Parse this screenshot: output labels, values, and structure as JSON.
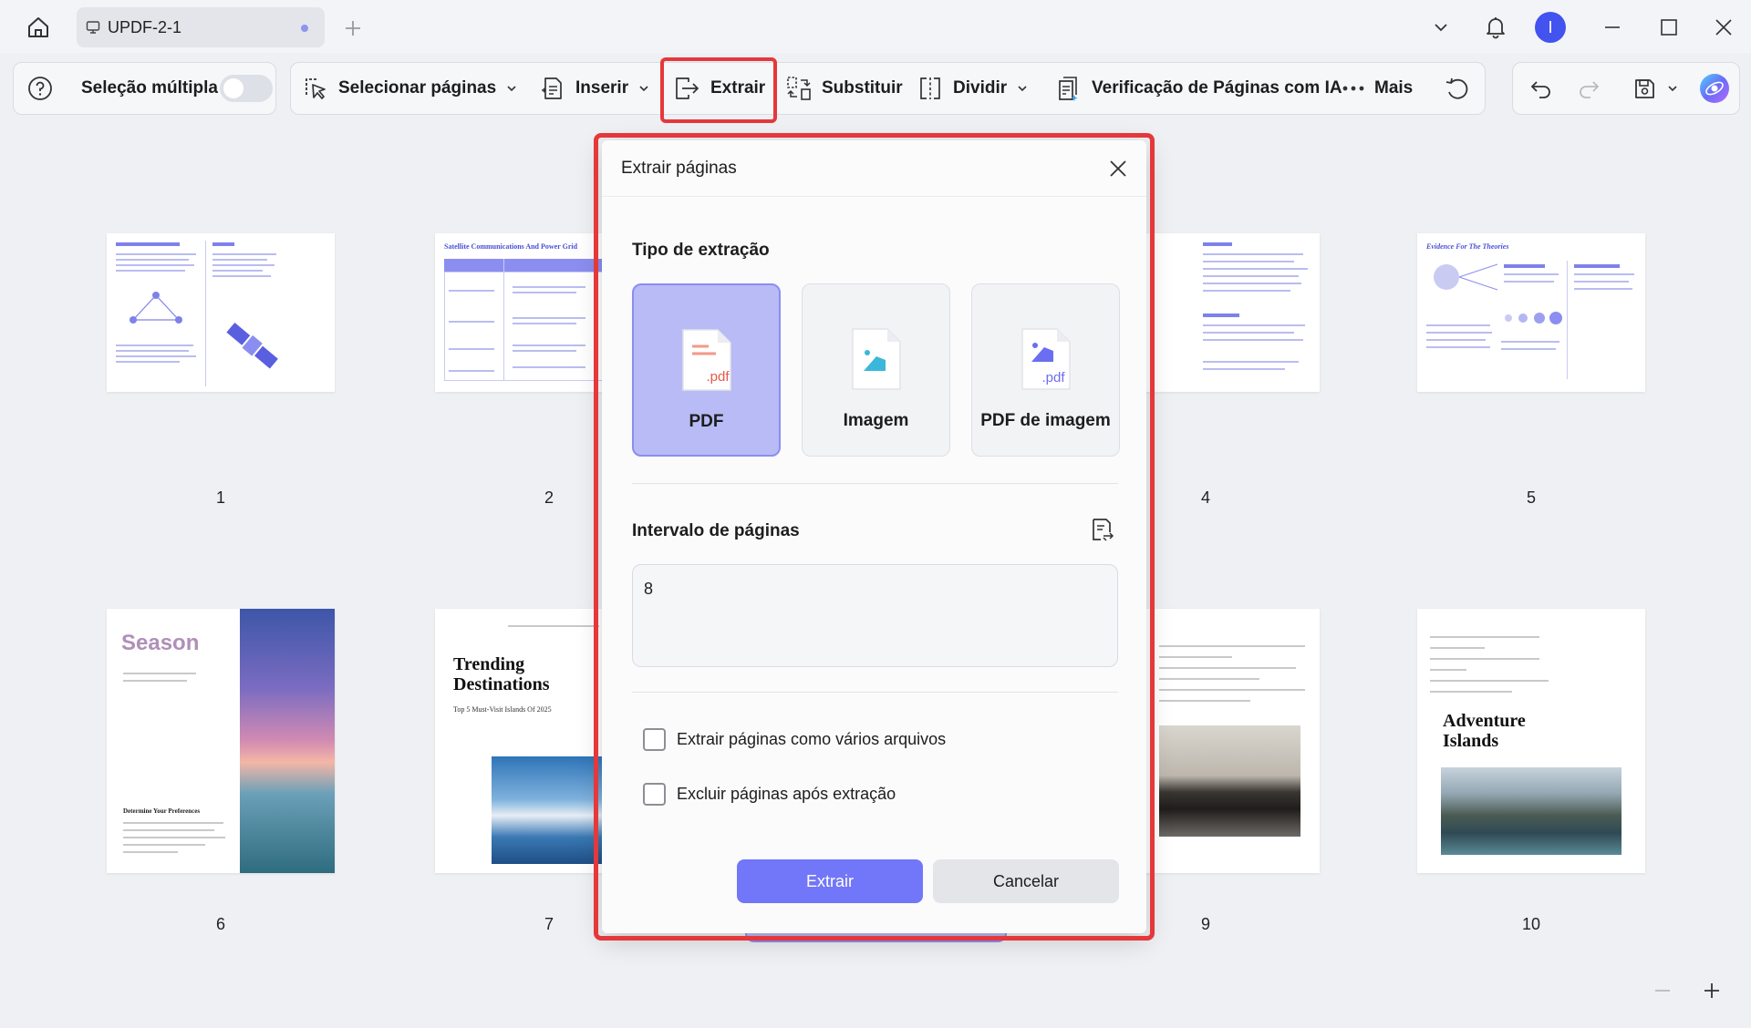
{
  "window": {
    "tab_title": "UPDF-2-1",
    "avatar_initial": "I"
  },
  "toolbar": {
    "multi_select_label": "Seleção múltipla",
    "select_pages_label": "Selecionar páginas",
    "insert_label": "Inserir",
    "extract_label": "Extrair",
    "replace_label": "Substituir",
    "split_label": "Dividir",
    "ai_check_label": "Verificação de Páginas com IA",
    "more_label": "Mais"
  },
  "pages": [
    {
      "number": "1"
    },
    {
      "number": "2",
      "heading": "Satellite Communications And Power Grid"
    },
    {
      "number": "4"
    },
    {
      "number": "5",
      "heading": "Evidence For The Theories"
    },
    {
      "number": "6",
      "heading": "Season",
      "subheading": "Determine Your Preferences"
    },
    {
      "number": "7",
      "heading": "Trending Destinations",
      "subheading": "Top 5 Must-Visit Islands Of 2025"
    },
    {
      "number": "9"
    },
    {
      "number": "10",
      "heading": "Adventure Islands"
    }
  ],
  "dialog": {
    "title": "Extrair páginas",
    "extraction_type_label": "Tipo de extração",
    "options": [
      {
        "label": "PDF",
        "icon_text": ".pdf",
        "selected": true
      },
      {
        "label": "Imagem",
        "selected": false
      },
      {
        "label": "PDF de imagem",
        "icon_text": ".pdf",
        "selected": false
      }
    ],
    "page_range_label": "Intervalo de páginas",
    "page_range_value": "8",
    "checkbox_multiple_files": "Extrair páginas como vários arquivos",
    "checkbox_delete_after": "Excluir páginas após extração",
    "extract_button": "Extrair",
    "cancel_button": "Cancelar"
  },
  "colors": {
    "accent": "#7276f8",
    "selected_card": "#b8bbf5",
    "highlight": "#e5383b",
    "avatar": "#4253f0"
  }
}
